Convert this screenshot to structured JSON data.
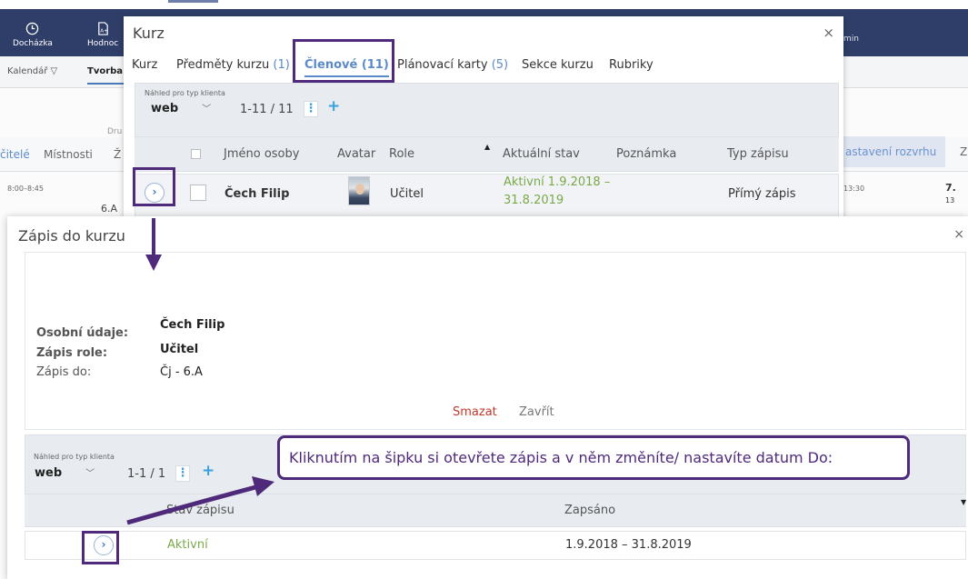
{
  "header": {
    "nav": [
      {
        "label": "Docházka",
        "icon": "clock-icon"
      },
      {
        "label": "Hodnoc",
        "icon": "grade-sheet-icon"
      }
    ],
    "admin_label": "min"
  },
  "subnav": {
    "items": [
      "Kalendář ▽",
      "Tvorba r"
    ]
  },
  "background": {
    "dru": "Dru",
    "tabs": [
      "čitelé",
      "Místnosti",
      "Ž"
    ],
    "time_left": "8:00–8:45",
    "class_label": "6.A",
    "rozvrh_label": "astavení rozvrhu",
    "z_label": "Z",
    "time_right": "13:30",
    "period": "7.",
    "period_time": "13"
  },
  "kurz": {
    "title": "Kurz",
    "close": "×",
    "tabs": [
      {
        "label": "Kurz",
        "count": ""
      },
      {
        "label": "Předměty kurzu",
        "count": "(1)"
      },
      {
        "label": "Členové (11)",
        "count": ""
      },
      {
        "label": "Plánovací karty",
        "count": "(5)"
      },
      {
        "label": "Sekce kurzu",
        "count": ""
      },
      {
        "label": "Rubriky",
        "count": ""
      }
    ],
    "toolbar": {
      "client_label": "Náhled pro typ klienta",
      "client_value": "web",
      "range": "1-11 / 11",
      "kebab": "⋮",
      "add": "+"
    },
    "columns": {
      "name": "Jméno osoby",
      "avatar": "Avatar",
      "role": "Role",
      "status": "Aktuální stav",
      "note": "Poznámka",
      "type": "Typ zápisu"
    },
    "row": {
      "expand": "›",
      "name": "Čech Filip",
      "role": "Učitel",
      "status_line1": "Aktivní 1.9.2018 –",
      "status_line2": "31.8.2019",
      "type": "Přímý zápis"
    }
  },
  "zapis": {
    "title": "Zápis do kurzu",
    "close": "×",
    "fields": {
      "personal_label": "Osobní údaje:",
      "personal_value": "Čech Filip",
      "role_label": "Zápis role:",
      "role_value": "Učitel",
      "target_label": "Zápis do:",
      "target_value": "Čj - 6.A"
    },
    "actions": {
      "delete": "Smazat",
      "close": "Zavřít"
    },
    "toolbar": {
      "client_label": "Náhled pro typ klienta",
      "client_value": "web",
      "range": "1-1 / 1",
      "kebab": "⋮",
      "add": "+"
    },
    "columns": {
      "status": "Stav zápisu",
      "enrolled": "Zapsáno"
    },
    "row": {
      "expand": "›",
      "status": "Aktivní",
      "enrolled": "1.9.2018 – 31.8.2019"
    }
  },
  "annotation": {
    "text": "Kliknutím na šipku si otevřete zápis a v něm změníte/ nastavíte datum Do:",
    "color": "#4f2a7a"
  }
}
